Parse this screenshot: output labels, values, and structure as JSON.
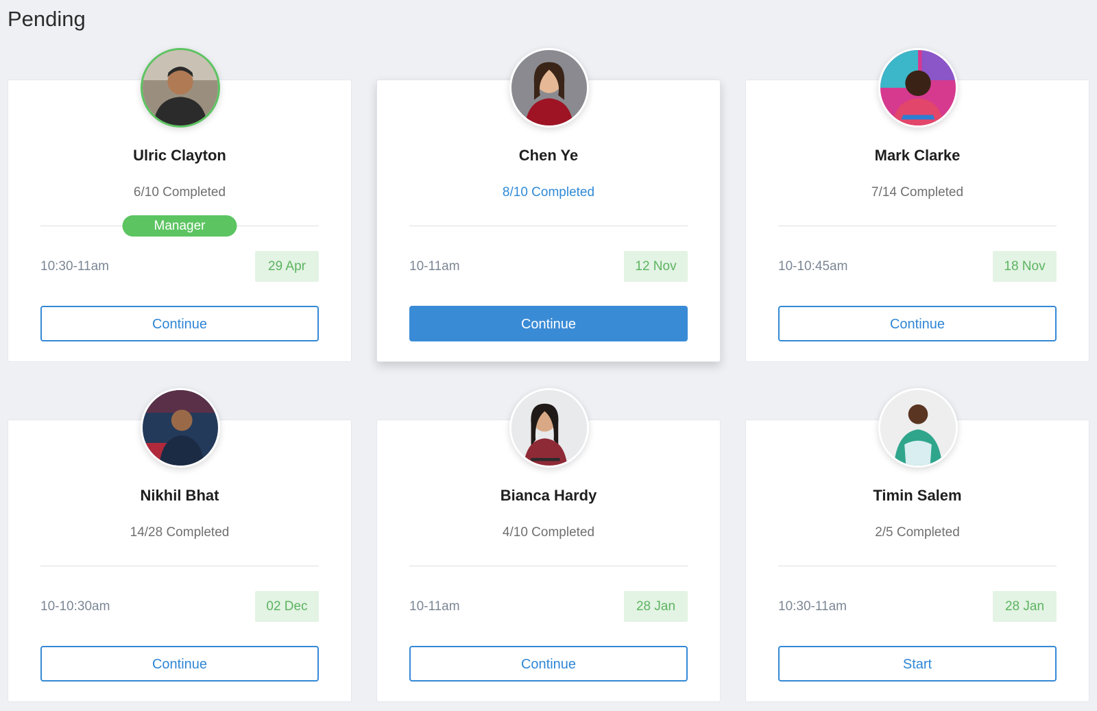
{
  "page": {
    "title": "Pending"
  },
  "colors": {
    "accent_blue": "#3a8bd6",
    "success_green": "#5cc461",
    "chip_bg": "#e3f3e4"
  },
  "cards": [
    {
      "name": "Ulric Clayton",
      "progress": "6/10 Completed",
      "badge": "Manager",
      "time": "10:30-11am",
      "date": "29 Apr",
      "button": "Continue"
    },
    {
      "name": "Chen Ye",
      "progress": "8/10 Completed",
      "time": "10-11am",
      "date": "12 Nov",
      "button": "Continue"
    },
    {
      "name": "Mark Clarke",
      "progress": "7/14 Completed",
      "time": "10-10:45am",
      "date": "18 Nov",
      "button": "Continue"
    },
    {
      "name": "Nikhil Bhat",
      "progress": "14/28 Completed",
      "time": "10-10:30am",
      "date": "02 Dec",
      "button": "Continue"
    },
    {
      "name": "Bianca Hardy",
      "progress": "4/10 Completed",
      "time": "10-11am",
      "date": "28 Jan",
      "button": "Continue"
    },
    {
      "name": "Timin Salem",
      "progress": "2/5 Completed",
      "time": "10:30-11am",
      "date": "28 Jan",
      "button": "Start"
    }
  ]
}
